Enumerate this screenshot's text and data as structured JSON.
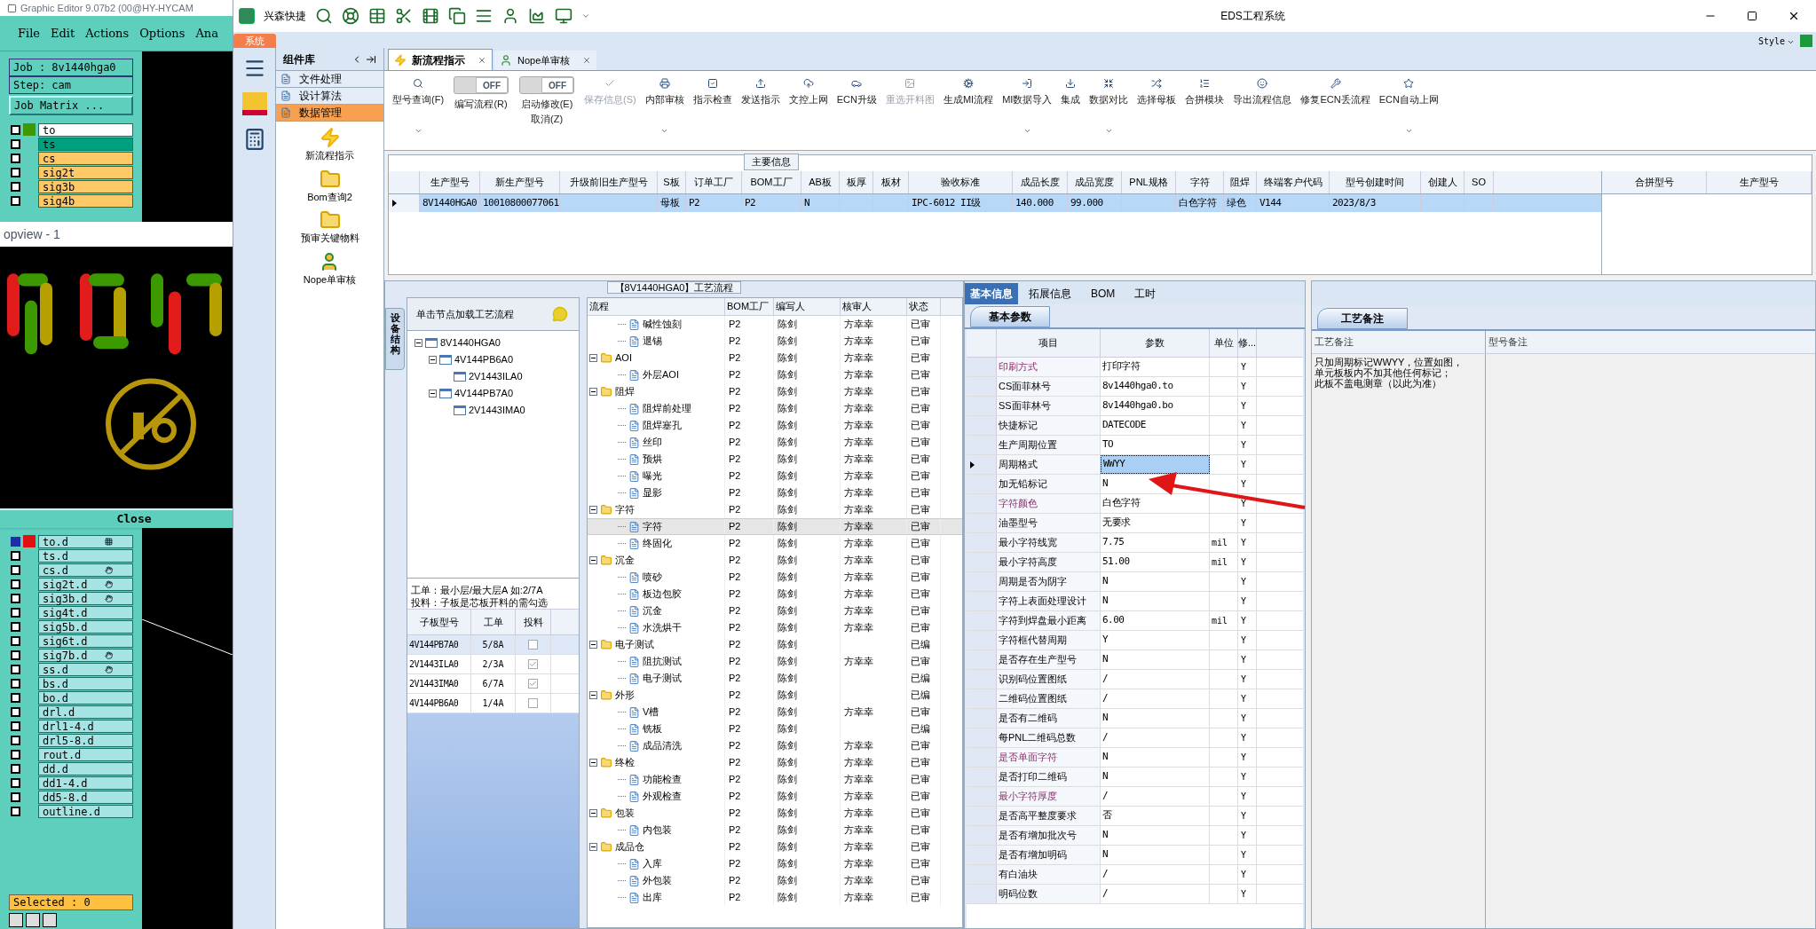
{
  "editor": {
    "title": "Graphic Editor 9.07b2 (00@HY-HYCAM",
    "menu": [
      "File",
      "Edit",
      "Actions",
      "Options",
      "Ana"
    ],
    "job": "Job : 8v1440hga0",
    "step": "Step: cam",
    "matrix_button": "Job Matrix ...",
    "layers": [
      {
        "name": "to",
        "color": "#ffffff",
        "affected": true,
        "checked": false
      },
      {
        "name": "ts",
        "color": "#00a07e",
        "affected": false,
        "checked": false
      },
      {
        "name": "cs",
        "color": "#ffc866",
        "affected": false,
        "checked": false
      },
      {
        "name": "sig2t",
        "color": "#ffc866",
        "affected": false,
        "checked": false
      },
      {
        "name": "sig3b",
        "color": "#ffc866",
        "affected": false,
        "checked": false
      },
      {
        "name": "sig4b",
        "color": "#ffc866",
        "affected": false,
        "checked": false
      }
    ],
    "popup": {
      "title": "opview - 1",
      "close": "Close"
    },
    "board_layers": [
      {
        "name": "to.d",
        "work": true,
        "checked": false,
        "kind": "grid"
      },
      {
        "name": "ts.d",
        "work": false,
        "checked": false,
        "kind": "plain"
      },
      {
        "name": "cs.d",
        "work": false,
        "checked": false,
        "kind": "hand"
      },
      {
        "name": "sig2t.d",
        "work": false,
        "checked": false,
        "kind": "hand"
      },
      {
        "name": "sig3b.d",
        "work": false,
        "checked": false,
        "kind": "hand"
      },
      {
        "name": "sig4t.d",
        "work": false,
        "checked": false,
        "kind": "plain"
      },
      {
        "name": "sig5b.d",
        "work": false,
        "checked": false,
        "kind": "plain"
      },
      {
        "name": "sig6t.d",
        "work": false,
        "checked": false,
        "kind": "plain"
      },
      {
        "name": "sig7b.d",
        "work": false,
        "checked": false,
        "kind": "hand"
      },
      {
        "name": "ss.d",
        "work": false,
        "checked": false,
        "kind": "hand"
      },
      {
        "name": "bs.d",
        "work": false,
        "checked": false,
        "kind": "plain"
      },
      {
        "name": "bo.d",
        "work": false,
        "checked": false,
        "kind": "plain"
      },
      {
        "name": "drl.d",
        "work": false,
        "checked": false,
        "kind": "plain"
      },
      {
        "name": "drl1-4.d",
        "work": false,
        "checked": false,
        "kind": "plain"
      },
      {
        "name": "drl5-8.d",
        "work": false,
        "checked": false,
        "kind": "plain"
      },
      {
        "name": "rout.d",
        "work": false,
        "checked": false,
        "kind": "plain"
      },
      {
        "name": "dd.d",
        "work": false,
        "checked": false,
        "kind": "plain"
      },
      {
        "name": "dd1-4.d",
        "work": false,
        "checked": false,
        "kind": "plain"
      },
      {
        "name": "dd5-8.d",
        "work": false,
        "checked": false,
        "kind": "plain"
      },
      {
        "name": "outline.d",
        "work": false,
        "checked": false,
        "kind": "plain"
      }
    ],
    "selected": "Selected : 0"
  },
  "app": {
    "brand": "兴森快捷",
    "title": "EDS工程系统",
    "system_tab": "系统",
    "style_menu": "Style"
  },
  "library": {
    "title": "组件库",
    "groups": [
      {
        "label": "文件处理",
        "selected": false
      },
      {
        "label": "设计算法",
        "selected": false
      },
      {
        "label": "数据管理",
        "selected": true
      }
    ],
    "tools": [
      {
        "label": "新流程指示",
        "kind": "flash"
      },
      {
        "label": "Bom查询2",
        "kind": "folder"
      },
      {
        "label": "预审关键物料",
        "kind": "folder"
      },
      {
        "label": "Nope单审核",
        "kind": "user"
      }
    ]
  },
  "doc_tabs": [
    {
      "label": "新流程指示",
      "selected": true
    },
    {
      "label": "Nope单审核",
      "selected": false
    }
  ],
  "toolbar": [
    {
      "kind": "button",
      "label": "型号查询(F)",
      "disabled": false,
      "dropdown": true
    },
    {
      "kind": "toggle",
      "label": "编写流程(R)",
      "switch": "OFF",
      "on": false
    },
    {
      "kind": "toggle",
      "label": "启动修改(E)",
      "label2": "取消(Z)",
      "switch": "OFF",
      "on": false
    },
    {
      "kind": "button",
      "label": "保存信息(S)",
      "disabled": true,
      "dropdown": false
    },
    {
      "kind": "button",
      "label": "内部审核",
      "disabled": false,
      "dropdown": true
    },
    {
      "kind": "button",
      "label": "指示检查",
      "disabled": false,
      "dropdown": false
    },
    {
      "kind": "button",
      "label": "发送指示",
      "disabled": false,
      "dropdown": false
    },
    {
      "kind": "button",
      "label": "文控上网",
      "disabled": false,
      "dropdown": false
    },
    {
      "kind": "button",
      "label": "ECN升级",
      "disabled": false,
      "dropdown": false
    },
    {
      "kind": "button",
      "label": "重选开料图",
      "disabled": true,
      "dropdown": false
    },
    {
      "kind": "button",
      "label": "生成MI流程",
      "disabled": false,
      "dropdown": false
    },
    {
      "kind": "button",
      "label": "MI数据导入",
      "disabled": false,
      "dropdown": true
    },
    {
      "kind": "button",
      "label": "集成",
      "disabled": false,
      "dropdown": false
    },
    {
      "kind": "button",
      "label": "数据对比",
      "disabled": false,
      "dropdown": true
    },
    {
      "kind": "button",
      "label": "选择母板",
      "disabled": false,
      "dropdown": false
    },
    {
      "kind": "button",
      "label": "合拼模块",
      "disabled": false,
      "dropdown": false
    },
    {
      "kind": "button",
      "label": "导出流程信息",
      "disabled": false,
      "dropdown": false
    },
    {
      "kind": "button",
      "label": "修复ECN丢流程",
      "disabled": false,
      "dropdown": false
    },
    {
      "kind": "button",
      "label": "ECN自动上网",
      "disabled": false,
      "dropdown": true
    }
  ],
  "main_info": {
    "title": "主要信息",
    "columns": [
      "生产型号",
      "新生产型号",
      "升级前旧生产型号",
      "S板",
      "订单工厂",
      "BOM工厂",
      "AB板",
      "板厚",
      "板材",
      "验收标准",
      "成品长度",
      "成品宽度",
      "PNL规格",
      "字符",
      "阻焊",
      "终端客户代码",
      "型号创建时间",
      "创建人",
      "SO"
    ],
    "rows": [
      {
        "selected": true,
        "cells": [
          "8V1440HGA0",
          "10010800077061",
          null,
          "母板",
          "P2",
          "P2",
          "N",
          null,
          null,
          "IPC-6012 II级",
          "140.000",
          "99.000",
          null,
          "白色字符",
          "绿色",
          "V144",
          "2023/8/3",
          null,
          null
        ]
      }
    ],
    "side_columns": [
      "合拼型号",
      "生产型号"
    ]
  },
  "process": {
    "title": "【8V1440HGA0】工艺流程",
    "side_tab": "设备结构",
    "hint": "单击节点加载工艺流程",
    "tree": [
      {
        "label": "8V1440HGA0",
        "expanded": true,
        "children": [
          {
            "label": "4V144PB6A0",
            "expanded": true,
            "children": [
              {
                "label": "2V1443ILA0"
              }
            ]
          },
          {
            "label": "4V144PB7A0",
            "expanded": true,
            "children": [
              {
                "label": "2V1443IMA0"
              }
            ]
          }
        ]
      }
    ],
    "notes": [
      "工单：最小层/最大层A 如:2/7A",
      "投料：子板是芯板开料的需勾选"
    ],
    "boards": {
      "columns": [
        "子板型号",
        "工单",
        "投料"
      ],
      "rows": [
        {
          "model": "4V144PB7A0",
          "order": "5/8A",
          "feed": false,
          "selected": true
        },
        {
          "model": "2V1443ILA0",
          "order": "2/3A",
          "feed": true,
          "selected": false
        },
        {
          "model": "2V1443IMA0",
          "order": "6/7A",
          "feed": true,
          "selected": false
        },
        {
          "model": "4V144PB6A0",
          "order": "1/4A",
          "feed": false,
          "selected": false
        }
      ]
    }
  },
  "flow": {
    "columns": [
      "流程",
      "BOM工厂",
      "编写人",
      "核审人",
      "状态"
    ],
    "rows": [
      {
        "kind": "continued",
        "children": [
          {
            "kind": "step",
            "label": "碱性蚀刻",
            "bom": "P2",
            "writer": "陈剑",
            "reviewer": "方幸幸",
            "status": "已审",
            "selected": false
          },
          {
            "kind": "step",
            "label": "退锡",
            "bom": "P2",
            "writer": "陈剑",
            "reviewer": "方幸幸",
            "status": "已审",
            "selected": false
          }
        ]
      },
      {
        "kind": "group",
        "label": "AOI",
        "expanded": true,
        "bom": "P2",
        "writer": "陈剑",
        "reviewer": "方幸幸",
        "status": "已审",
        "selected": false,
        "children": [
          {
            "kind": "step",
            "label": "外层AOI",
            "bom": "P2",
            "writer": "陈剑",
            "reviewer": "方幸幸",
            "status": "已审",
            "selected": false
          }
        ]
      },
      {
        "kind": "group",
        "label": "阻焊",
        "expanded": true,
        "bom": "P2",
        "writer": "陈剑",
        "reviewer": "方幸幸",
        "status": "已审",
        "selected": false,
        "children": [
          {
            "kind": "step",
            "label": "阻焊前处理",
            "bom": "P2",
            "writer": "陈剑",
            "reviewer": "方幸幸",
            "status": "已审",
            "selected": false
          },
          {
            "kind": "step",
            "label": "阻焊塞孔",
            "bom": "P2",
            "writer": "陈剑",
            "reviewer": "方幸幸",
            "status": "已审",
            "selected": false
          },
          {
            "kind": "step",
            "label": "丝印",
            "bom": "P2",
            "writer": "陈剑",
            "reviewer": "方幸幸",
            "status": "已审",
            "selected": false
          },
          {
            "kind": "step",
            "label": "预烘",
            "bom": "P2",
            "writer": "陈剑",
            "reviewer": "方幸幸",
            "status": "已审",
            "selected": false
          },
          {
            "kind": "step",
            "label": "曝光",
            "bom": "P2",
            "writer": "陈剑",
            "reviewer": "方幸幸",
            "status": "已审",
            "selected": false
          },
          {
            "kind": "step",
            "label": "显影",
            "bom": "P2",
            "writer": "陈剑",
            "reviewer": "方幸幸",
            "status": "已审",
            "selected": false
          }
        ]
      },
      {
        "kind": "group",
        "label": "字符",
        "expanded": true,
        "bom": "P2",
        "writer": "陈剑",
        "reviewer": "方幸幸",
        "status": "已审",
        "selected": false,
        "children": [
          {
            "kind": "step",
            "label": "字符",
            "bom": "P2",
            "writer": "陈剑",
            "reviewer": "方幸幸",
            "status": "已审",
            "selected": true
          },
          {
            "kind": "step",
            "label": "终固化",
            "bom": "P2",
            "writer": "陈剑",
            "reviewer": "方幸幸",
            "status": "已审",
            "selected": false
          }
        ]
      },
      {
        "kind": "group",
        "label": "沉金",
        "expanded": true,
        "bom": "P2",
        "writer": "陈剑",
        "reviewer": "方幸幸",
        "status": "已审",
        "selected": false,
        "children": [
          {
            "kind": "step",
            "label": "喷砂",
            "bom": "P2",
            "writer": "陈剑",
            "reviewer": "方幸幸",
            "status": "已审",
            "selected": false
          },
          {
            "kind": "step",
            "label": "板边包胶",
            "bom": "P2",
            "writer": "陈剑",
            "reviewer": "方幸幸",
            "status": "已审",
            "selected": false
          },
          {
            "kind": "step",
            "label": "沉金",
            "bom": "P2",
            "writer": "陈剑",
            "reviewer": "方幸幸",
            "status": "已审",
            "selected": false
          },
          {
            "kind": "step",
            "label": "水洗烘干",
            "bom": "P2",
            "writer": "陈剑",
            "reviewer": "方幸幸",
            "status": "已审",
            "selected": false
          }
        ]
      },
      {
        "kind": "group",
        "label": "电子测试",
        "expanded": true,
        "bom": "P2",
        "writer": "陈剑",
        "status": "已编",
        "selected": false,
        "children": [
          {
            "kind": "step",
            "label": "阻抗测试",
            "bom": "P2",
            "writer": "陈剑",
            "reviewer": "方幸幸",
            "status": "已审",
            "selected": false
          },
          {
            "kind": "step",
            "label": "电子测试",
            "bom": "P2",
            "writer": "陈剑",
            "status": "已编",
            "selected": false
          }
        ]
      },
      {
        "kind": "group",
        "label": "外形",
        "expanded": true,
        "bom": "P2",
        "writer": "陈剑",
        "status": "已编",
        "selected": false,
        "children": [
          {
            "kind": "step",
            "label": "V槽",
            "bom": "P2",
            "writer": "陈剑",
            "reviewer": "方幸幸",
            "status": "已审",
            "selected": false
          },
          {
            "kind": "step",
            "label": "铣板",
            "bom": "P2",
            "writer": "陈剑",
            "status": "已编",
            "selected": false
          },
          {
            "kind": "step",
            "label": "成品清洗",
            "bom": "P2",
            "writer": "陈剑",
            "reviewer": "方幸幸",
            "status": "已审",
            "selected": false
          }
        ]
      },
      {
        "kind": "group",
        "label": "终检",
        "expanded": true,
        "bom": "P2",
        "writer": "陈剑",
        "reviewer": "方幸幸",
        "status": "已审",
        "selected": false,
        "children": [
          {
            "kind": "step",
            "label": "功能检查",
            "bom": "P2",
            "writer": "陈剑",
            "reviewer": "方幸幸",
            "status": "已审",
            "selected": false
          },
          {
            "kind": "step",
            "label": "外观检查",
            "bom": "P2",
            "writer": "陈剑",
            "reviewer": "方幸幸",
            "status": "已审",
            "selected": false
          }
        ]
      },
      {
        "kind": "group",
        "label": "包装",
        "expanded": true,
        "bom": "P2",
        "writer": "陈剑",
        "reviewer": "方幸幸",
        "status": "已审",
        "selected": false,
        "children": [
          {
            "kind": "step",
            "label": "内包装",
            "bom": "P2",
            "writer": "陈剑",
            "reviewer": "方幸幸",
            "status": "已审",
            "selected": false
          }
        ]
      },
      {
        "kind": "group",
        "label": "成品仓",
        "expanded": true,
        "bom": "P2",
        "writer": "陈剑",
        "reviewer": "方幸幸",
        "status": "已审",
        "selected": false,
        "children": [
          {
            "kind": "step",
            "label": "入库",
            "bom": "P2",
            "writer": "陈剑",
            "reviewer": "方幸幸",
            "status": "已审",
            "selected": false
          },
          {
            "kind": "step",
            "label": "外包装",
            "bom": "P2",
            "writer": "陈剑",
            "reviewer": "方幸幸",
            "status": "已审",
            "selected": false
          },
          {
            "kind": "step",
            "label": "出库",
            "bom": "P2",
            "writer": "陈剑",
            "reviewer": "方幸幸",
            "status": "已审",
            "selected": false
          }
        ]
      }
    ]
  },
  "params": {
    "tabs": [
      {
        "label": "基本信息",
        "selected": true
      },
      {
        "label": "拓展信息",
        "selected": false
      },
      {
        "label": "BOM",
        "selected": false
      },
      {
        "label": "工时",
        "selected": false
      }
    ],
    "sub_tab": "基本参数",
    "columns": [
      "项目",
      "参数",
      "单位",
      "修..."
    ],
    "rows": [
      {
        "item": "印刷方式",
        "value": "打印字符",
        "flag": "Y",
        "emphasis": true,
        "selected": false
      },
      {
        "item": "CS面菲林号",
        "value": "8v1440hga0.to",
        "flag": "Y",
        "emphasis": false,
        "selected": false
      },
      {
        "item": "SS面菲林号",
        "value": "8v1440hga0.bo",
        "flag": "Y",
        "emphasis": false,
        "selected": false
      },
      {
        "item": "快捷标记",
        "value": "DATECODE",
        "flag": "Y",
        "emphasis": false,
        "selected": false
      },
      {
        "item": "生产周期位置",
        "value": "TO",
        "flag": "Y",
        "emphasis": false,
        "selected": false
      },
      {
        "item": "周期格式",
        "value": "WWYY",
        "flag": "Y",
        "emphasis": false,
        "selected": true
      },
      {
        "item": "加无铅标记",
        "value": "N",
        "flag": "Y",
        "emphasis": false,
        "selected": false
      },
      {
        "item": "字符颜色",
        "value": "白色字符",
        "flag": "Y",
        "emphasis": true,
        "selected": false
      },
      {
        "item": "油墨型号",
        "value": "无要求",
        "flag": "Y",
        "emphasis": false,
        "selected": false
      },
      {
        "item": "最小字符线宽",
        "value": "7.75",
        "unit": "mil",
        "flag": "Y",
        "emphasis": false,
        "selected": false
      },
      {
        "item": "最小字符高度",
        "value": "51.00",
        "unit": "mil",
        "flag": "Y",
        "emphasis": false,
        "selected": false
      },
      {
        "item": "周期是否为阴字",
        "value": "N",
        "flag": "Y",
        "emphasis": false,
        "selected": false
      },
      {
        "item": "字符上表面处理设计",
        "value": "N",
        "flag": "Y",
        "emphasis": false,
        "selected": false
      },
      {
        "item": "字符到焊盘最小距离",
        "value": "6.00",
        "unit": "mil",
        "flag": "Y",
        "emphasis": false,
        "selected": false
      },
      {
        "item": "字符框代替周期",
        "value": "Y",
        "flag": "Y",
        "emphasis": false,
        "selected": false
      },
      {
        "item": "是否存在生产型号",
        "value": "N",
        "flag": "Y",
        "emphasis": false,
        "selected": false
      },
      {
        "item": "识别码位置图纸",
        "value": "/",
        "flag": "Y",
        "emphasis": false,
        "selected": false
      },
      {
        "item": "二维码位置图纸",
        "value": "/",
        "flag": "Y",
        "emphasis": false,
        "selected": false
      },
      {
        "item": "是否有二维码",
        "value": "N",
        "flag": "Y",
        "emphasis": false,
        "selected": false
      },
      {
        "item": "每PNL二维码总数",
        "value": "/",
        "flag": "Y",
        "emphasis": false,
        "selected": false
      },
      {
        "item": "是否单面字符",
        "value": "N",
        "flag": "Y",
        "emphasis": true,
        "selected": false
      },
      {
        "item": "是否打印二维码",
        "value": "N",
        "flag": "Y",
        "emphasis": false,
        "selected": false
      },
      {
        "item": "最小字符厚度",
        "value": "/",
        "flag": "Y",
        "emphasis": true,
        "selected": false
      },
      {
        "item": "是否高平整度要求",
        "value": "否",
        "flag": "Y",
        "emphasis": false,
        "selected": false
      },
      {
        "item": "是否有增加批次号",
        "value": "N",
        "flag": "Y",
        "emphasis": false,
        "selected": false
      },
      {
        "item": "是否有增加明码",
        "value": "N",
        "flag": "Y",
        "emphasis": false,
        "selected": false
      },
      {
        "item": "有白油块",
        "value": "/",
        "flag": "Y",
        "emphasis": false,
        "selected": false
      },
      {
        "item": "明码位数",
        "value": "/",
        "flag": "Y",
        "emphasis": false,
        "selected": false
      }
    ]
  },
  "remarks": {
    "tab": "工艺备注",
    "columns": [
      "工艺备注",
      "型号备注"
    ],
    "lines": [
      "只加周期标记WWYY，位置如图，",
      "单元板板内不加其他任何标记；",
      "此板不盖电测章（以此为准）"
    ]
  }
}
